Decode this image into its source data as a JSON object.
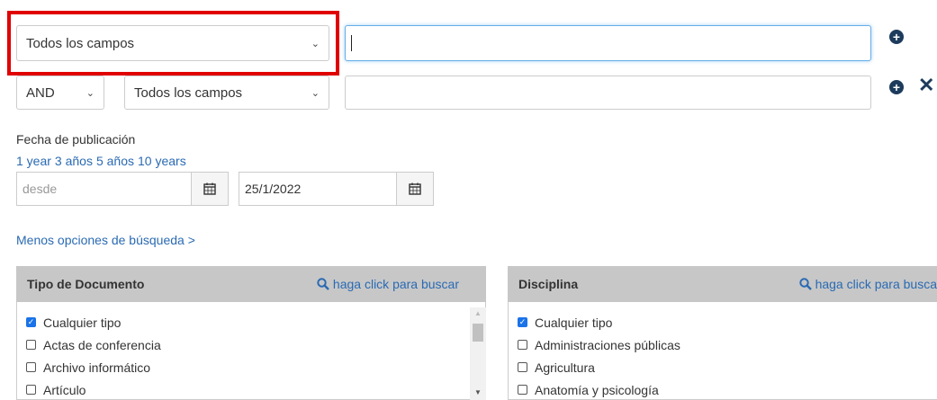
{
  "search": {
    "row1": {
      "field": "Todos los campos",
      "value": ""
    },
    "row2": {
      "operator": "AND",
      "field": "Todos los campos",
      "value": ""
    }
  },
  "icons": {
    "add": "plus-circle-icon",
    "remove": "close-icon",
    "chevron": "chevron-down-icon",
    "calendar": "calendar-icon",
    "search": "search-icon"
  },
  "date": {
    "label": "Fecha de publicación",
    "quick": [
      "1 year",
      "3 años",
      "5 años",
      "10 years"
    ],
    "from_placeholder": "desde",
    "to_value": "25/1/2022"
  },
  "less_options": "Menos opciones de búsqueda >",
  "facets": {
    "doc_type": {
      "title": "Tipo de Documento",
      "search_label": "haga click para buscar",
      "items": [
        {
          "label": "Cualquier tipo",
          "checked": true
        },
        {
          "label": "Actas de conferencia",
          "checked": false
        },
        {
          "label": "Archivo informático",
          "checked": false
        },
        {
          "label": "Artículo",
          "checked": false
        }
      ]
    },
    "discipline": {
      "title": "Disciplina",
      "search_label": "haga click para busca",
      "items": [
        {
          "label": "Cualquier tipo",
          "checked": true
        },
        {
          "label": "Administraciones públicas",
          "checked": false
        },
        {
          "label": "Agricultura",
          "checked": false
        },
        {
          "label": "Anatomía y psicología",
          "checked": false
        }
      ]
    }
  },
  "colors": {
    "link": "#2a6ab3",
    "highlight": "#e00000",
    "header_bg": "#c7c7c7",
    "icon_dark": "#1d3b5c"
  }
}
